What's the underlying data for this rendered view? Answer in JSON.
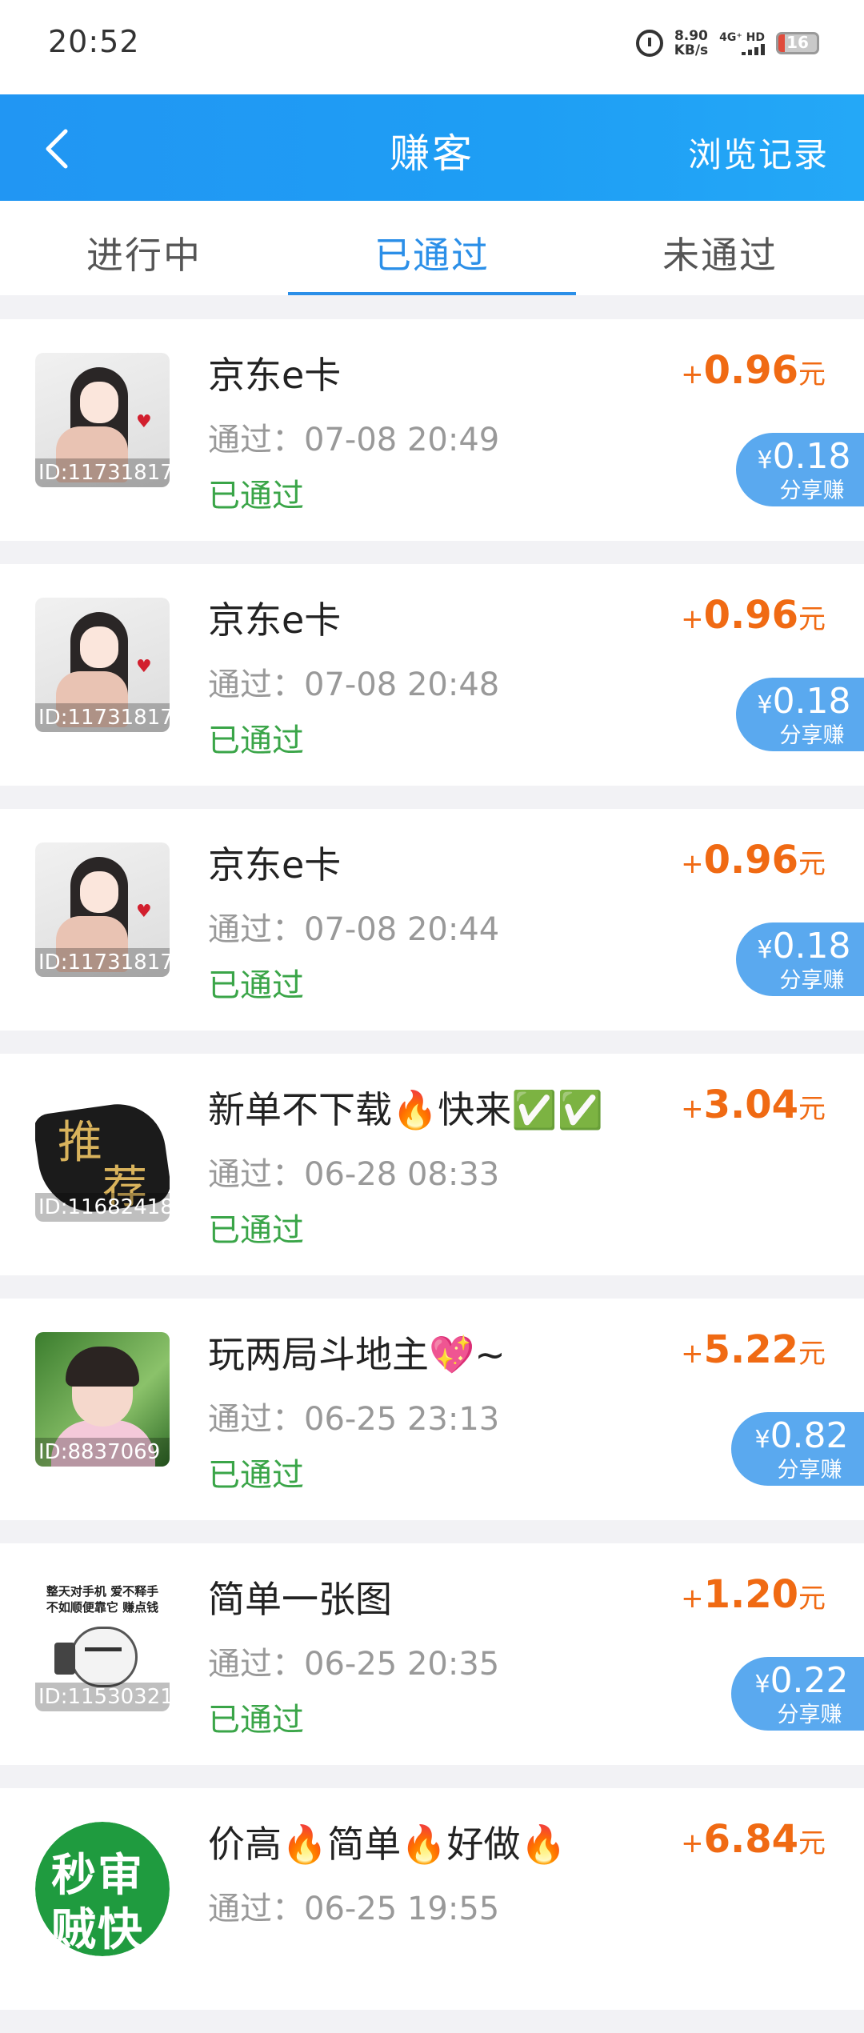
{
  "status_bar": {
    "time": "20:52",
    "net_speed_value": "8.90",
    "net_speed_unit": "KB/s",
    "network": "4G⁺ HD",
    "battery": "16",
    "battery_level": 0.16
  },
  "header": {
    "title": "赚客",
    "action": "浏览记录"
  },
  "tabs": [
    {
      "label": "进行中",
      "active": false
    },
    {
      "label": "已通过",
      "active": true
    },
    {
      "label": "未通过",
      "active": false
    }
  ],
  "items": [
    {
      "title": "京东e卡",
      "time": "通过：07-08 20:49",
      "status": "已通过",
      "plus": "+",
      "amount": "0.96",
      "unit": "元",
      "id": "ID:11731817",
      "share_yen": "¥",
      "share_value": "0.18",
      "share_label": "分享赚"
    },
    {
      "title": "京东e卡",
      "time": "通过：07-08 20:48",
      "status": "已通过",
      "plus": "+",
      "amount": "0.96",
      "unit": "元",
      "id": "ID:11731817",
      "share_yen": "¥",
      "share_value": "0.18",
      "share_label": "分享赚"
    },
    {
      "title": "京东e卡",
      "time": "通过：07-08 20:44",
      "status": "已通过",
      "plus": "+",
      "amount": "0.96",
      "unit": "元",
      "id": "ID:11731817",
      "share_yen": "¥",
      "share_value": "0.18",
      "share_label": "分享赚"
    },
    {
      "title": "新单不下载🔥快来✅✅",
      "time": "通过：06-28 08:33",
      "status": "已通过",
      "plus": "+",
      "amount": "3.04",
      "unit": "元",
      "id": "ID:11682418",
      "thumb_text_1": "推",
      "thumb_text_2": "荐"
    },
    {
      "title": "玩两局斗地主💖~",
      "time": "通过：06-25 23:13",
      "status": "已通过",
      "plus": "+",
      "amount": "5.22",
      "unit": "元",
      "id": "ID:8837069",
      "share_yen": "¥",
      "share_value": "0.82",
      "share_label": "分享赚"
    },
    {
      "title": "简单一张图",
      "time": "通过：06-25 20:35",
      "status": "已通过",
      "plus": "+",
      "amount": "1.20",
      "unit": "元",
      "id": "ID:11530321",
      "share_yen": "¥",
      "share_value": "0.22",
      "share_label": "分享赚",
      "thumb_text_1": "整天对手机 爱不释手",
      "thumb_text_2": "不如顺便靠它 赚点钱"
    },
    {
      "title": "价高🔥简单🔥好做🔥",
      "time": "通过：06-25 19:55",
      "status": "已通过",
      "plus": "+",
      "amount": "6.84",
      "unit": "元",
      "thumb_text_1": "秒审",
      "thumb_text_2": "贼快"
    }
  ],
  "colors": {
    "header": "#2196f3",
    "tab_active": "#2b8fe8",
    "reward": "#f06a13",
    "status_passed": "#3aa548",
    "share_badge": "#5aa9ef"
  }
}
